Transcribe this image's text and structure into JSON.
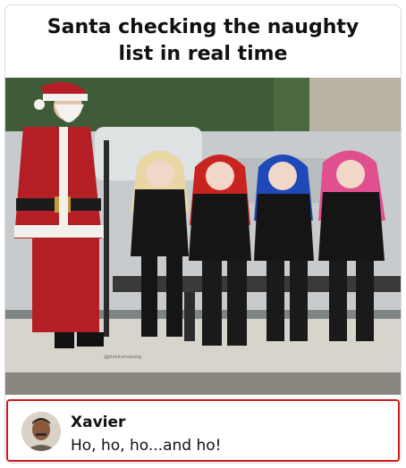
{
  "post": {
    "caption": "Santa checking the naughty list in real time"
  },
  "photo": {
    "watermark": "@pixelcanvasing",
    "colors": {
      "santa_red": "#b41e24",
      "hair_blonde": "#e8d7a4",
      "hair_red": "#c8231f",
      "hair_blue": "#1f49b8",
      "hair_pink": "#e0508f"
    }
  },
  "comment": {
    "author": "Xavier",
    "text": "Ho, ho, ho...and ho!",
    "border_color": "#d11a1a"
  }
}
